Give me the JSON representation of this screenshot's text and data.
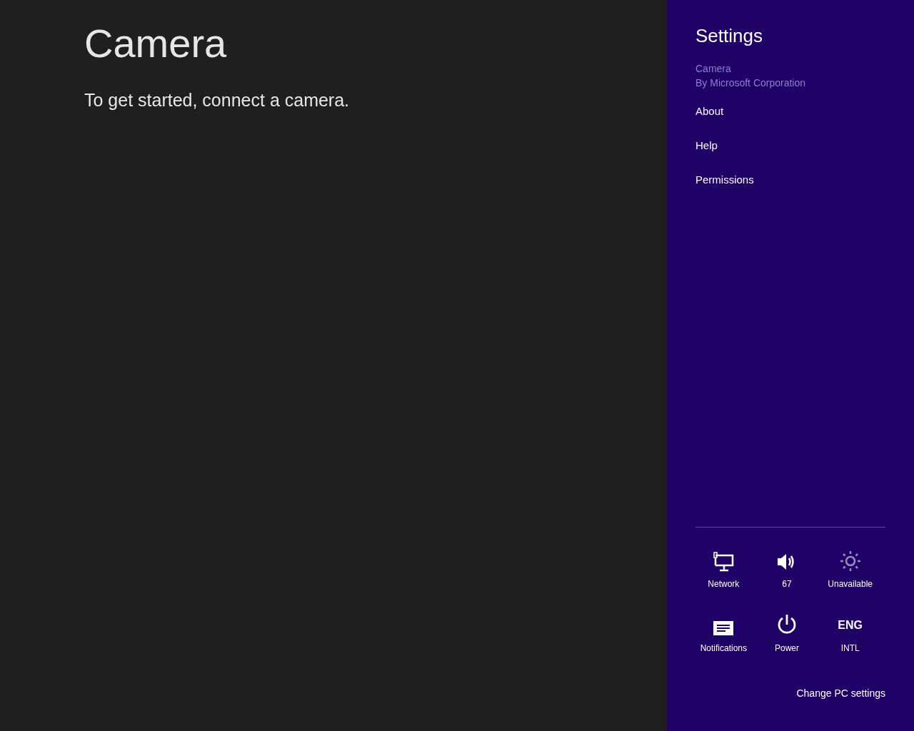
{
  "app": {
    "title": "Camera",
    "message": "To get started, connect a camera."
  },
  "settings": {
    "title": "Settings",
    "app_name": "Camera",
    "publisher": "By Microsoft Corporation",
    "items": [
      "About",
      "Help",
      "Permissions"
    ],
    "tiles": [
      {
        "kind": "network",
        "label": "Network",
        "disabled": false
      },
      {
        "kind": "volume",
        "label": "67",
        "disabled": false
      },
      {
        "kind": "brightness",
        "label": "Unavailable",
        "disabled": true
      },
      {
        "kind": "notifications",
        "label": "Notifications",
        "disabled": false
      },
      {
        "kind": "power",
        "label": "Power",
        "disabled": false
      },
      {
        "kind": "language",
        "glyph": "ENG",
        "label": "INTL",
        "disabled": false
      }
    ],
    "footer_link": "Change PC settings"
  }
}
